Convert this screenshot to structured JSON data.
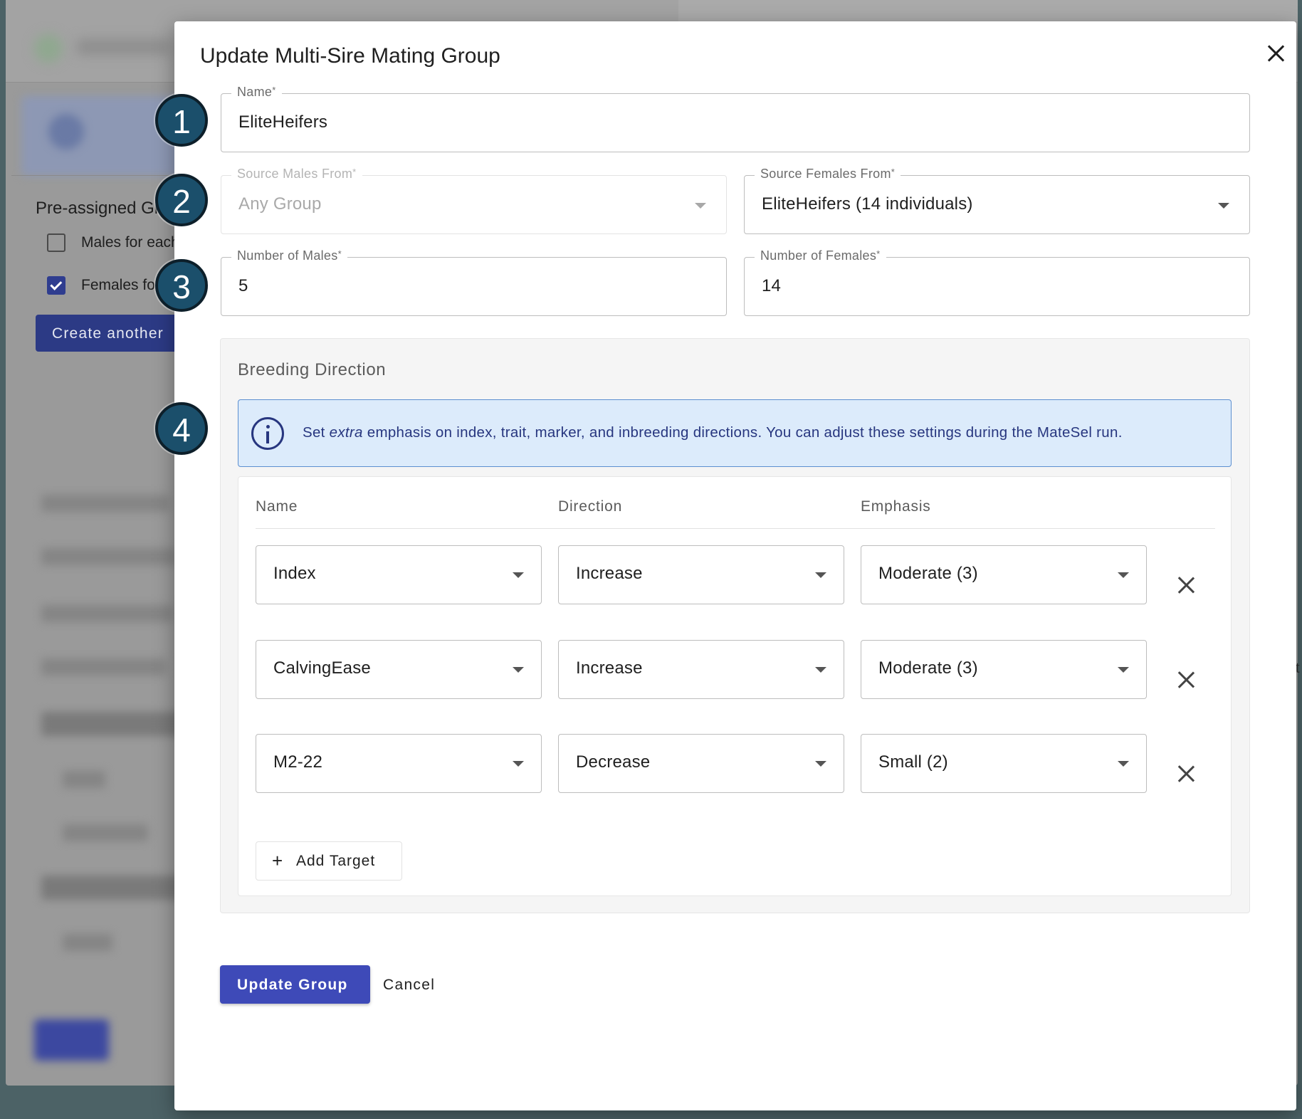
{
  "background": {
    "heading": "Pre-assigned Gr",
    "checkboxes": [
      {
        "label": "Males for each",
        "checked": false
      },
      {
        "label": "Females for",
        "checked": true
      }
    ],
    "create_button": "Create another",
    "right_edge_glyph": "t"
  },
  "modal": {
    "title": "Update Multi-Sire Mating Group",
    "name_field": {
      "label": "Name",
      "required_mark": "*",
      "value": "EliteHeifers"
    },
    "source_males": {
      "label": "Source Males From",
      "required_mark": "*",
      "value": "Any Group",
      "disabled": true
    },
    "source_females": {
      "label": "Source Females From",
      "required_mark": "*",
      "value": "EliteHeifers (14 individuals)"
    },
    "num_males": {
      "label": "Number of Males",
      "required_mark": "*",
      "value": "5"
    },
    "num_females": {
      "label": "Number of Females",
      "required_mark": "*",
      "value": "14"
    },
    "breeding": {
      "title": "Breeding Direction",
      "info_prefix": "Set ",
      "info_emphasis": "extra",
      "info_suffix": " emphasis on index, trait, marker, and inbreeding directions. You can adjust these settings during the MateSel run.",
      "columns": {
        "name": "Name",
        "direction": "Direction",
        "emphasis": "Emphasis"
      },
      "targets": [
        {
          "name": "Index",
          "direction": "Increase",
          "emphasis": "Moderate (3)"
        },
        {
          "name": "CalvingEase",
          "direction": "Increase",
          "emphasis": "Moderate (3)"
        },
        {
          "name": "M2-22",
          "direction": "Decrease",
          "emphasis": "Small (2)"
        }
      ],
      "add_target_plus": "+",
      "add_target_label": "Add Target"
    },
    "update_button": "Update Group",
    "cancel_button": "Cancel"
  },
  "callouts": [
    "1",
    "2",
    "3",
    "4"
  ],
  "colors": {
    "primary": "#3e4ab8",
    "info_bg": "#dcebfb",
    "info_text": "#27367f",
    "callout": "#1b4f6b"
  }
}
